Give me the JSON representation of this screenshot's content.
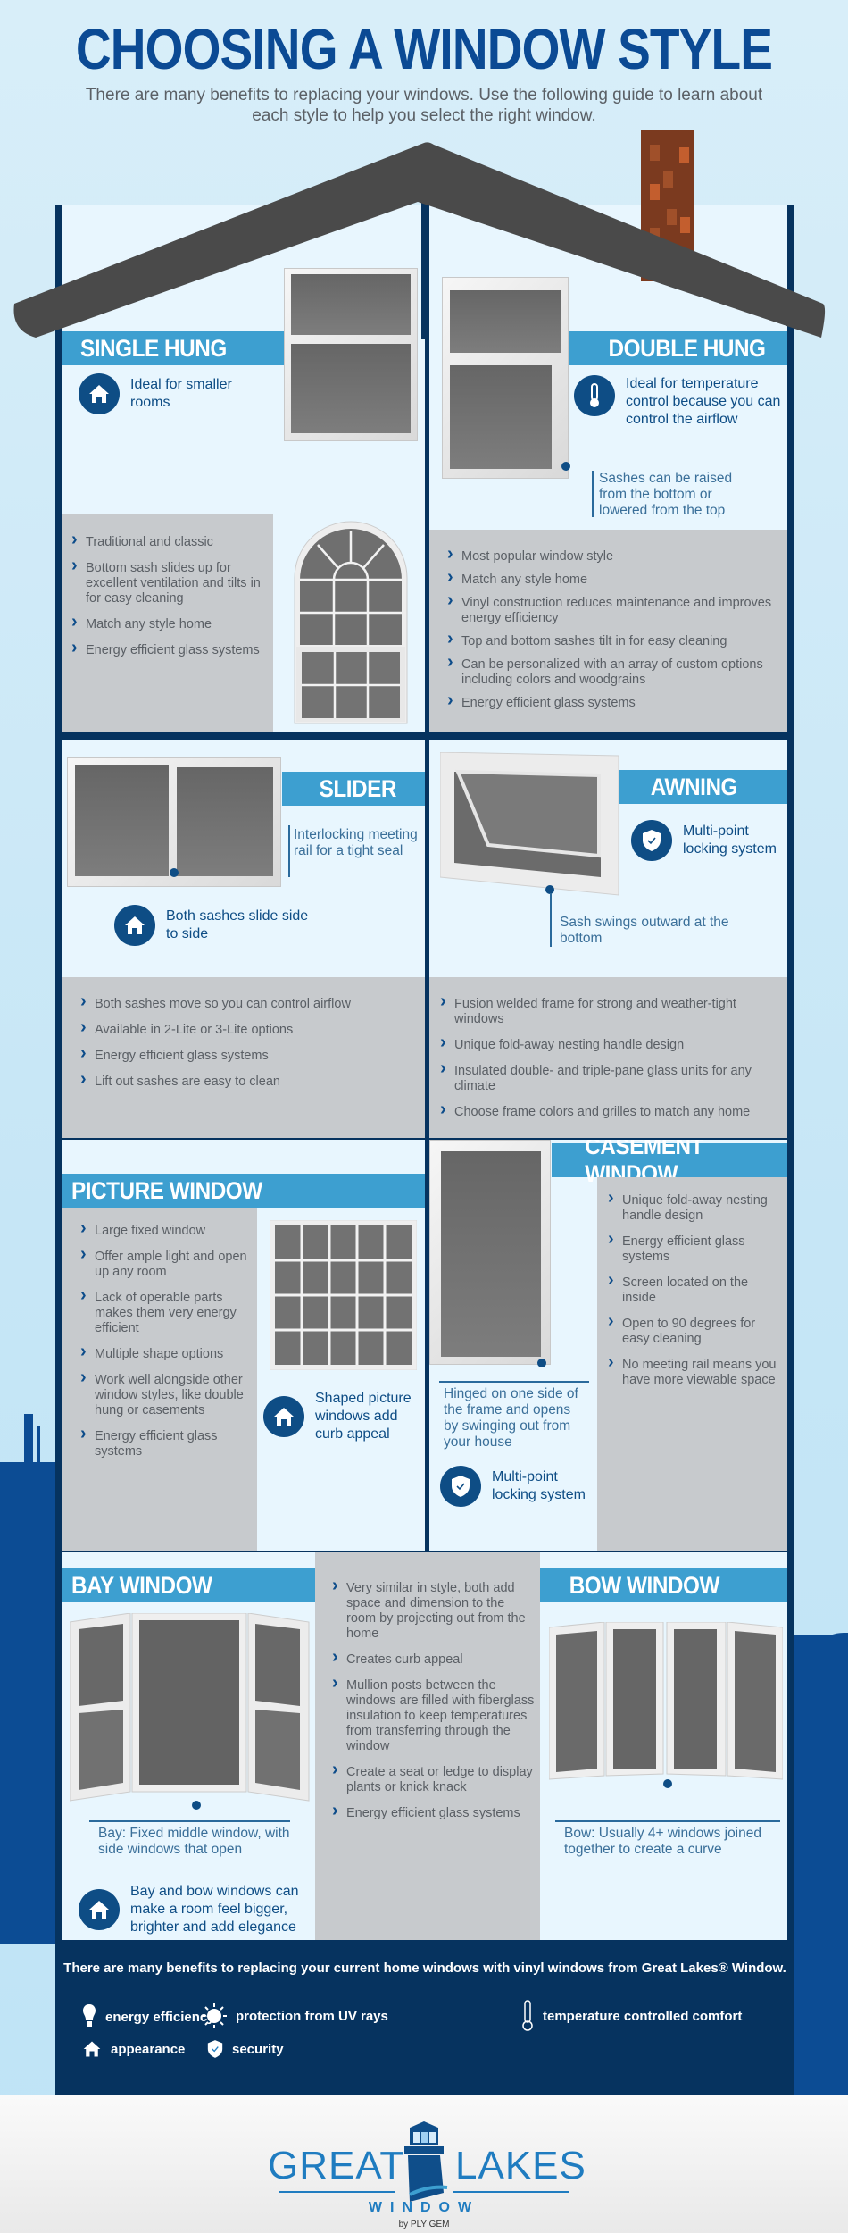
{
  "header": {
    "title": "CHOOSING A WINDOW STYLE",
    "subtitle": "There are many benefits to replacing your windows. Use the following guide to learn about each style to help you select the right window."
  },
  "colors": {
    "title_blue": "#0b4a94",
    "band_blue": "#3d9fd0",
    "house_navy": "#06335f",
    "panel_light": "#e8f6fe",
    "bullet_gray": "#c7cacd",
    "roof": "#4a4a4a",
    "chimney": "#7b3a1f"
  },
  "sections": {
    "single_hung": {
      "title": "SINGLE HUNG",
      "feature": "Ideal for smaller rooms",
      "feature_icon": "house-icon",
      "bullets": [
        "Traditional and classic",
        "Bottom sash slides up for excellent ventilation and tilts in for easy cleaning",
        "Match any style home",
        "Energy efficient glass systems"
      ]
    },
    "double_hung": {
      "title": "DOUBLE HUNG",
      "feature": "Ideal for temperature control because you can control the airflow",
      "feature_icon": "thermometer-icon",
      "callout": "Sashes can be raised from the bottom or lowered from the top",
      "bullets": [
        "Most popular window style",
        "Match any style home",
        "Vinyl construction reduces maintenance and improves energy efficiency",
        "Top and bottom sashes tilt in for easy cleaning",
        "Can be personalized with an array of custom options including colors and woodgrains",
        "Energy efficient glass systems"
      ]
    },
    "slider": {
      "title": "SLIDER",
      "callout": "Interlocking meeting rail for a tight seal",
      "feature": "Both sashes slide side to side",
      "feature_icon": "house-icon",
      "bullets": [
        "Both sashes move so you can control airflow",
        "Available in 2-Lite or 3-Lite options",
        "Energy efficient glass systems",
        "Lift out sashes are easy to clean"
      ]
    },
    "awning": {
      "title": "AWNING",
      "feature": "Multi-point locking system",
      "feature_icon": "shield-icon",
      "callout": "Sash swings outward at the bottom",
      "bullets": [
        "Fusion welded frame for strong and weather-tight windows",
        "Unique fold-away nesting handle design",
        "Insulated double- and triple-pane glass units for any climate",
        "Choose frame colors and grilles to match any home"
      ]
    },
    "picture": {
      "title": "PICTURE WINDOW",
      "bullets": [
        "Large fixed window",
        "Offer ample light and open up any room",
        "Lack of operable parts makes them very energy efficient",
        "Multiple shape options",
        "Work well alongside other window styles, like double hung or casements",
        "Energy efficient glass systems"
      ],
      "feature": "Shaped picture windows add curb appeal",
      "feature_icon": "house-icon"
    },
    "casement": {
      "title": "CASEMENT WINDOW",
      "callout": "Hinged on one side of the frame and opens by swinging out from your house",
      "feature": "Multi-point locking system",
      "feature_icon": "shield-icon",
      "bullets": [
        "Unique fold-away nesting handle design",
        "Energy efficient glass systems",
        "Screen located on the inside",
        "Open to 90 degrees for easy cleaning",
        "No meeting rail means you have more viewable space"
      ]
    },
    "bay": {
      "title": "BAY WINDOW",
      "callout": "Bay: Fixed middle window, with side windows that open",
      "feature": "Bay and bow windows can make a room feel bigger, brighter and add elegance",
      "feature_icon": "house-icon"
    },
    "bay_bow_shared": {
      "bullets": [
        "Very similar in style, both add space and dimension to the room by projecting out from the home",
        "Creates curb appeal",
        "Mullion posts between the windows are filled with fiberglass insulation to keep temperatures from transferring through the window",
        "Create a seat or ledge to display plants or knick knack",
        "Energy efficient glass systems"
      ]
    },
    "bow": {
      "title": "BOW WINDOW",
      "callout": "Bow: Usually 4+ windows joined together to create a curve"
    }
  },
  "benefits": {
    "title": "There are many benefits to replacing your current home windows with vinyl windows from Great Lakes® Window.",
    "items": [
      {
        "icon": "lightbulb-icon",
        "label": "energy efficiency"
      },
      {
        "icon": "sun-icon",
        "label": "protection from UV rays"
      },
      {
        "icon": "thermometer-icon",
        "label": "temperature controlled comfort"
      },
      {
        "icon": "house-icon",
        "label": "appearance"
      },
      {
        "icon": "shield-icon",
        "label": "security"
      }
    ]
  },
  "footer": {
    "logo_left": "GREAT",
    "logo_right": "LAKES",
    "logo_sub": "WINDOW",
    "byline": "by PLY GEM"
  }
}
